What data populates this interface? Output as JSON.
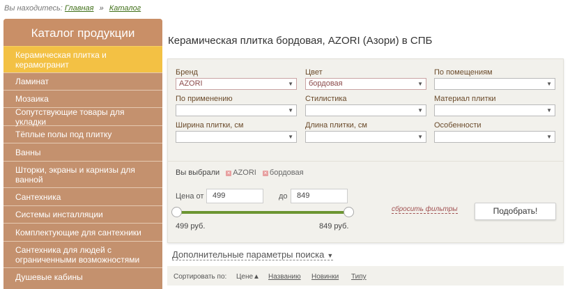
{
  "breadcrumb": {
    "prefix": "Вы находитесь:",
    "items": [
      "Главная",
      "Каталог"
    ],
    "separator": "»"
  },
  "sidebar": {
    "title": "Каталог продукции",
    "items": [
      {
        "label": "Керамическая плитка и керамогранит",
        "active": true
      },
      {
        "label": "Ламинат"
      },
      {
        "label": "Мозаика"
      },
      {
        "label": "Сопутствующие товары для укладки"
      },
      {
        "label": "Тёплые полы под плитку"
      },
      {
        "label": "Ванны"
      },
      {
        "label": "Шторки, экраны и карнизы для ванной"
      },
      {
        "label": "Сантехника"
      },
      {
        "label": "Системы инсталляции"
      },
      {
        "label": "Комплектующие для сантехники"
      },
      {
        "label": "Сантехника для людей с ограниченными возможностями"
      },
      {
        "label": "Душевые кабины"
      }
    ]
  },
  "page": {
    "title": "Керамическая плитка бордовая, AZORI (Азори) в СПБ"
  },
  "filters": {
    "brand": {
      "label": "Бренд",
      "value": "AZORI"
    },
    "color": {
      "label": "Цвет",
      "value": "бордовая"
    },
    "rooms": {
      "label": "По помещениям",
      "value": ""
    },
    "usage": {
      "label": "По применению",
      "value": ""
    },
    "style": {
      "label": "Стилистика",
      "value": ""
    },
    "material": {
      "label": "Материал плитки",
      "value": ""
    },
    "width": {
      "label": "Ширина плитки, см",
      "value": ""
    },
    "length": {
      "label": "Длина плитки, см",
      "value": ""
    },
    "features": {
      "label": "Особенности",
      "value": ""
    }
  },
  "chosen": {
    "label": "Вы выбрали",
    "chips": [
      "AZORI",
      "бордовая"
    ],
    "chip_remove_glyph": "×"
  },
  "price": {
    "from_label": "Цена от",
    "to_label": "до",
    "from_value": "499",
    "to_value": "849",
    "min_text": "499 руб.",
    "max_text": "849 руб."
  },
  "actions": {
    "reset": "сбросить фильтры",
    "apply": "Подобрать!"
  },
  "more_params": {
    "label": "Дополнительные параметры поиска",
    "arrow": "▼"
  },
  "sort": {
    "label": "Сортировать по:",
    "options": [
      "Цене",
      "Названию",
      "Новинки",
      "Типу"
    ],
    "current_arrow": "▲"
  },
  "icons": {
    "select_arrow": "▼"
  },
  "colors": {
    "sidebar_bg": "#c4916e",
    "sidebar_active": "#f3c144",
    "link_green": "#3f6f17",
    "slider": "#6c9532"
  }
}
